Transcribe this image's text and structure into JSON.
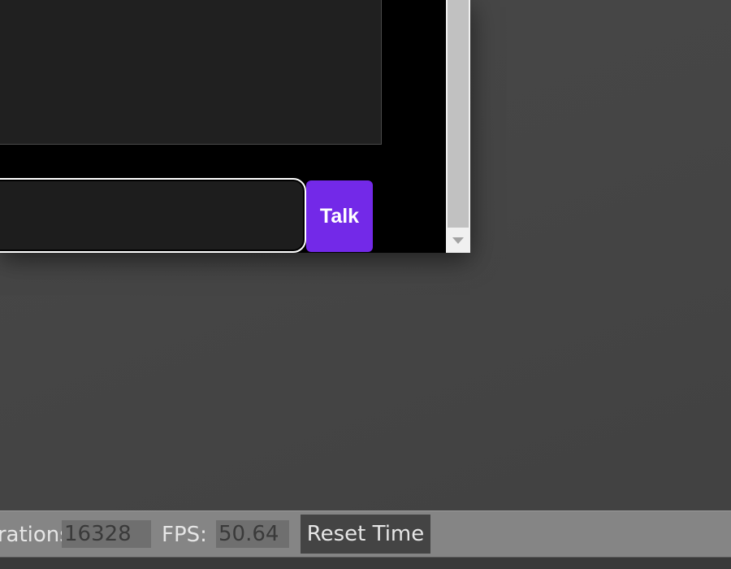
{
  "app": {
    "talk_button_label": "Talk",
    "chat_input_value": ""
  },
  "status_bar": {
    "iterations_label": "Iterations:",
    "iterations_value": "16328",
    "fps_label": "FPS:",
    "fps_value": "50.64",
    "reset_button_label": "Reset Time"
  },
  "icons": {
    "scroll_down": "chevron-down-icon"
  },
  "colors": {
    "talk_button": "#7329e8",
    "desktop_background": "#454545",
    "status_bar": "#858585",
    "status_value_field": "#6f6f6f",
    "reset_button": "#444444"
  }
}
